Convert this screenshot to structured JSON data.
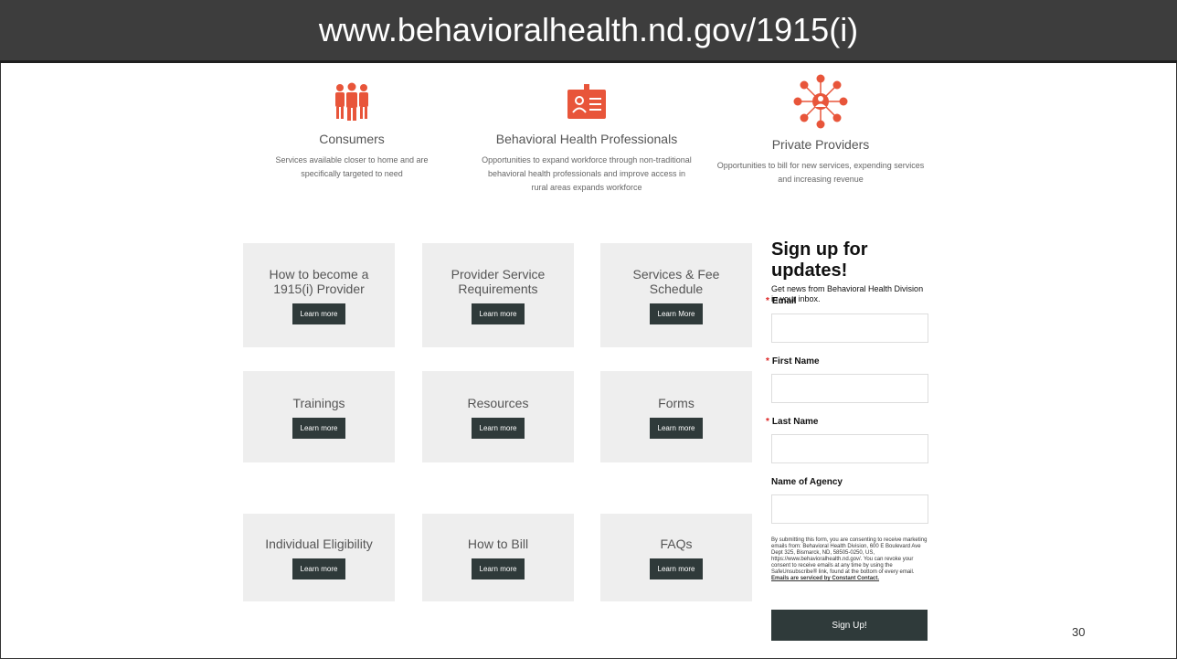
{
  "header": {
    "url": "www.behavioralhealth.nd.gov/1915(i)"
  },
  "features": [
    {
      "title": "Consumers",
      "description": "Services available closer to home and are specifically targeted to need",
      "icon": "people-group-icon"
    },
    {
      "title": "Behavioral Health Professionals",
      "description": "Opportunities to expand workforce through non-traditional behavioral health professionals and improve access in rural areas expands workforce",
      "icon": "id-badge-icon"
    },
    {
      "title": "Private Providers",
      "description": "Opportunities to bill for new services, expending services and increasing revenue",
      "icon": "network-hub-icon"
    }
  ],
  "tiles": [
    {
      "label": "How to become a\n1915(i) Provider",
      "button": "Learn more"
    },
    {
      "label": "Provider Service\nRequirements",
      "button": "Learn more"
    },
    {
      "label": "Services & Fee\nSchedule",
      "button": "Learn More"
    },
    {
      "label": "Trainings",
      "button": "Learn more"
    },
    {
      "label": "Resources",
      "button": "Learn more"
    },
    {
      "label": "Forms",
      "button": "Learn more"
    },
    {
      "label": "Individual Eligibility",
      "button": "Learn more"
    },
    {
      "label": "How to Bill",
      "button": "Learn more"
    },
    {
      "label": "FAQs",
      "button": "Learn more"
    }
  ],
  "signup": {
    "title": "Sign up for updates!",
    "subtitle": "Get news from Behavioral Health Division in your inbox.",
    "fields": [
      {
        "label": "Email",
        "required": true
      },
      {
        "label": "First Name",
        "required": true
      },
      {
        "label": "Last Name",
        "required": true
      },
      {
        "label": "Name of Agency",
        "required": false
      }
    ],
    "required_marker": "*",
    "consent": "By submitting this form, you are consenting to receive marketing emails from: Behavioral Health Division, 600 E Boulevard Ave Dept 325, Bismarck, ND, 58505-0250, US, https://www.behavioralhealth.nd.gov/. You can revoke your consent to receive emails at any time by using the SafeUnsubscribe® link, found at the bottom of every email.",
    "consent_link": "Emails are serviced by Constant Contact.",
    "button": "Sign Up!"
  },
  "page_number": "30",
  "colors": {
    "accent": "#e8553a",
    "title_bar": "#3d3d3d",
    "button": "#2f3a3a"
  }
}
